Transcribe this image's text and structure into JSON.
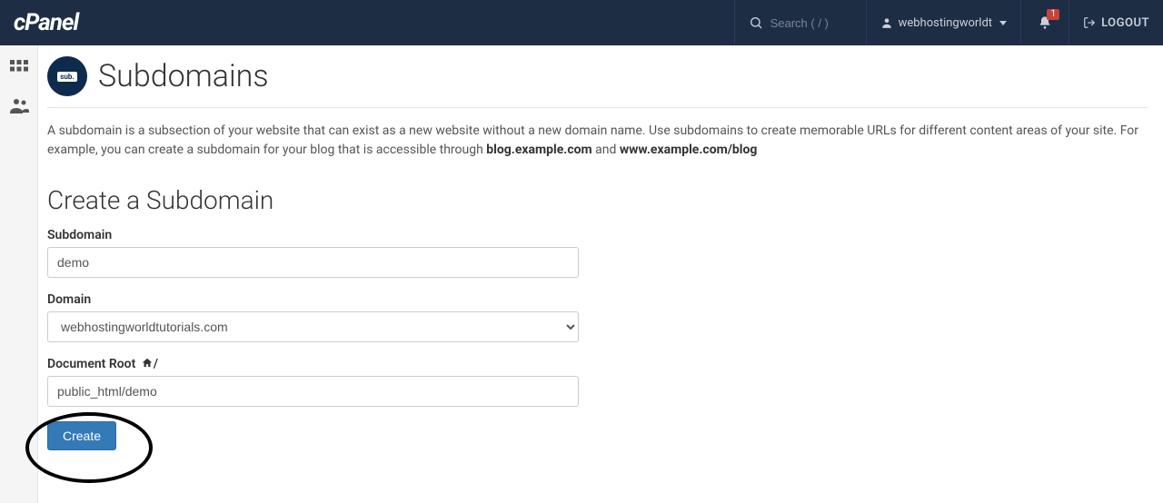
{
  "header": {
    "logo_text": "cPanel",
    "search_placeholder": "Search ( / )",
    "username": "webhostingworldt",
    "notification_count": "1",
    "logout_label": "LOGOUT"
  },
  "page": {
    "icon_label": "sub.",
    "title": "Subdomains",
    "description_1": "A subdomain is a subsection of your website that can exist as a new website without a new domain name. Use subdomains to create memorable URLs for different content areas of your site. For example, you can create a subdomain for your blog that is accessible through ",
    "description_bold_1": "blog.example.com",
    "description_mid": " and ",
    "description_bold_2": "www.example.com/blog"
  },
  "form": {
    "section_title": "Create a Subdomain",
    "subdomain_label": "Subdomain",
    "subdomain_value": "demo",
    "domain_label": "Domain",
    "domain_value": "webhostingworldtutorials.com",
    "docroot_label": "Document Root ",
    "docroot_suffix": "/",
    "docroot_value": "public_html/demo",
    "create_button": "Create"
  }
}
